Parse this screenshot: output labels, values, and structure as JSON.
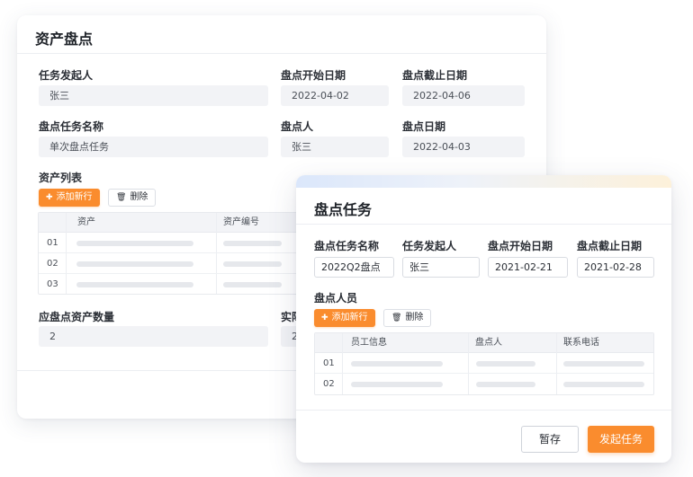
{
  "asset_inventory": {
    "title": "资产盘点",
    "fields": {
      "initiator": {
        "label": "任务发起人",
        "value": "张三"
      },
      "start_date": {
        "label": "盘点开始日期",
        "value": "2022-04-02"
      },
      "end_date": {
        "label": "盘点截止日期",
        "value": "2022-04-06"
      },
      "task_name": {
        "label": "盘点任务名称",
        "value": "单次盘点任务"
      },
      "counter": {
        "label": "盘点人",
        "value": "张三"
      },
      "count_date": {
        "label": "盘点日期",
        "value": "2022-04-03"
      }
    },
    "asset_list": {
      "label": "资产列表",
      "add_button": "添加新行",
      "delete_button": "删除",
      "columns": [
        "资产",
        "资产编号"
      ],
      "rows": [
        "01",
        "02",
        "03"
      ]
    },
    "expected_count": {
      "label": "应盘点资产数量",
      "value": "2"
    },
    "actual_count": {
      "label": "实际",
      "value": "2"
    }
  },
  "inventory_task": {
    "title": "盘点任务",
    "fields": {
      "task_name": {
        "label": "盘点任务名称",
        "value": "2022Q2盘点"
      },
      "initiator": {
        "label": "任务发起人",
        "value": "张三"
      },
      "start_date": {
        "label": "盘点开始日期",
        "value": "2021-02-21"
      },
      "end_date": {
        "label": "盘点截止日期",
        "value": "2021-02-28"
      }
    },
    "staff": {
      "label": "盘点人员",
      "add_button": "添加新行",
      "delete_button": "删除",
      "columns": [
        "员工信息",
        "盘点人",
        "联系电话"
      ],
      "rows": [
        "01",
        "02"
      ]
    },
    "save_button": "暂存",
    "submit_button": "发起任务"
  },
  "colors": {
    "accent": "#fa8c2e",
    "field_bg": "#f2f3f6",
    "table_header_bg": "#f3f4f7"
  }
}
